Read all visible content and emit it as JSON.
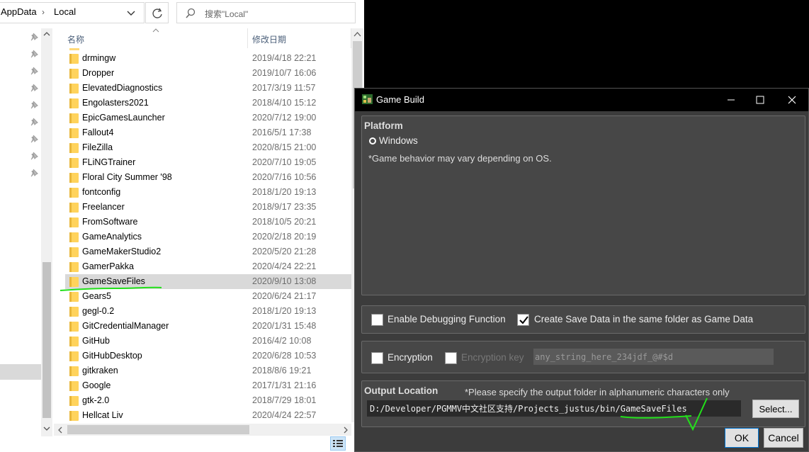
{
  "explorer": {
    "breadcrumb": [
      "AppData",
      "Local"
    ],
    "search_placeholder": "搜索\"Local\"",
    "columns": {
      "name": "名称",
      "date": "修改日期"
    },
    "files": [
      {
        "name": "drmingw",
        "date": "2019/4/18 22:21"
      },
      {
        "name": "Dropper",
        "date": "2019/10/7 16:06"
      },
      {
        "name": "ElevatedDiagnostics",
        "date": "2017/3/19 11:57"
      },
      {
        "name": "Engolasters2021",
        "date": "2018/4/10 15:12"
      },
      {
        "name": "EpicGamesLauncher",
        "date": "2020/7/12 19:00"
      },
      {
        "name": "Fallout4",
        "date": "2016/5/1 17:38"
      },
      {
        "name": "FileZilla",
        "date": "2020/8/15 21:00"
      },
      {
        "name": "FLiNGTrainer",
        "date": "2020/7/10 19:05"
      },
      {
        "name": "Floral City Summer '98",
        "date": "2020/7/16 10:56"
      },
      {
        "name": "fontconfig",
        "date": "2018/1/20 19:13"
      },
      {
        "name": "Freelancer",
        "date": "2018/9/17 23:35"
      },
      {
        "name": "FromSoftware",
        "date": "2018/10/5 20:21"
      },
      {
        "name": "GameAnalytics",
        "date": "2020/2/18 20:19"
      },
      {
        "name": "GameMakerStudio2",
        "date": "2020/5/20 21:28"
      },
      {
        "name": "GamerPakka",
        "date": "2020/4/24 22:21"
      },
      {
        "name": "GameSaveFiles",
        "date": "2020/9/10 13:08",
        "selected": true
      },
      {
        "name": "Gears5",
        "date": "2020/6/24 21:17"
      },
      {
        "name": "gegl-0.2",
        "date": "2018/1/20 19:13"
      },
      {
        "name": "GitCredentialManager",
        "date": "2020/1/31 15:48"
      },
      {
        "name": "GitHub",
        "date": "2016/4/2 10:08"
      },
      {
        "name": "GitHubDesktop",
        "date": "2020/6/28 10:53"
      },
      {
        "name": "gitkraken",
        "date": "2018/8/6 19:21"
      },
      {
        "name": "Google",
        "date": "2017/1/31 21:16"
      },
      {
        "name": "gtk-2.0",
        "date": "2018/7/29 18:01"
      },
      {
        "name": "Hellcat Liv",
        "date": "2020/4/24 22:57"
      }
    ]
  },
  "dialog": {
    "title": "Game Build",
    "platform": {
      "heading": "Platform",
      "option": "Windows",
      "note": "*Game behavior may vary depending on OS."
    },
    "debugging_label": "Enable Debugging Function",
    "same_folder_label": "Create Save Data in the same folder as Game Data",
    "encryption_label": "Encryption",
    "encryption_key_label": "Encryption key",
    "encryption_key_value": "any_string_here_234jdf_@#$d",
    "output": {
      "heading": "Output Location",
      "note": "*Please specify the output folder in alphanumeric characters only",
      "path": "D:/Developer/PGMMV中文社区支持/Projects_justus/bin/GameSaveFiles",
      "select_label": "Select..."
    },
    "ok_label": "OK",
    "cancel_label": "Cancel",
    "states": {
      "debugging": false,
      "same_folder": true,
      "encryption": false,
      "encryption_key": false
    }
  },
  "colors": {
    "annotation": "#22e01a",
    "dialog_bg": "#3c3c3c",
    "folder": "#ffd35c"
  }
}
